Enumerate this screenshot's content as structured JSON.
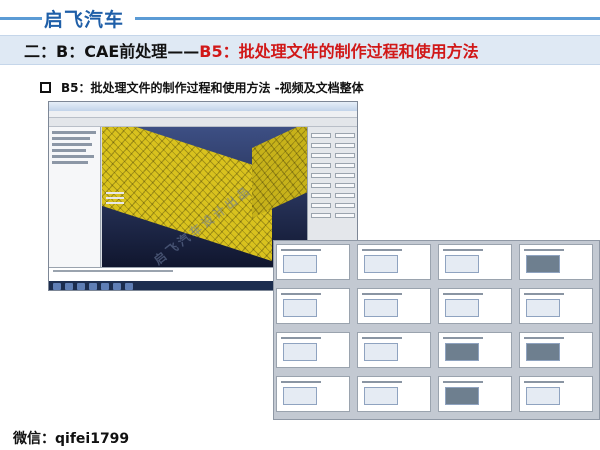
{
  "header": {
    "brand": "启飞汽车",
    "section_prefix": "二：B：CAE前处理——",
    "section_highlight": "B5：批处理文件的制作过程和使用方法"
  },
  "bullet": {
    "text": "B5：批处理文件的制作过程和使用方法 -视频及文档整体"
  },
  "watermark": {
    "text": "启飞汽车设计出品"
  },
  "footer": {
    "wechat": "微信：qifei1799"
  },
  "colors": {
    "brand_blue": "#1f5fa8",
    "rule_blue": "#5b9bd5",
    "highlight_red": "#d11818",
    "banner_bg": "#dfe9f4"
  },
  "icons": {
    "bullet": "square-outline-icon"
  }
}
